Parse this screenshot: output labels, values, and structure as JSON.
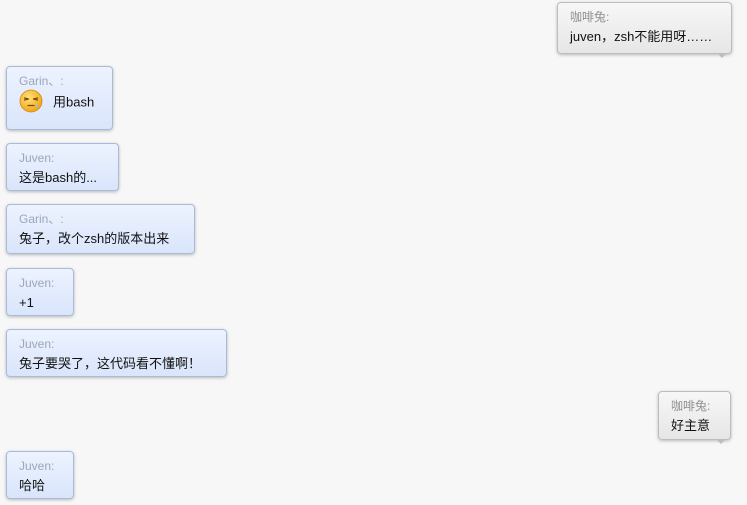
{
  "messages": [
    {
      "sender": "咖啡兔:",
      "text": "juven，zsh不能用呀……"
    },
    {
      "sender": "Garin、:",
      "text": "用bash",
      "icon": "sleepy-face-emoticon"
    },
    {
      "sender": "Juven:",
      "text": "这是bash的..."
    },
    {
      "sender": "Garin、:",
      "text": "兔子，改个zsh的版本出来"
    },
    {
      "sender": "Juven:",
      "text": "+1"
    },
    {
      "sender": "Juven:",
      "text": "兔子要哭了，这代码看不懂啊！"
    },
    {
      "sender": "咖啡兔:",
      "text": "好主意"
    },
    {
      "sender": "Juven:",
      "text": "哈哈"
    }
  ],
  "colors": {
    "incoming_bubble": "#dce7fb",
    "outgoing_bubble": "#ececec",
    "background": "#f7f7f7"
  }
}
